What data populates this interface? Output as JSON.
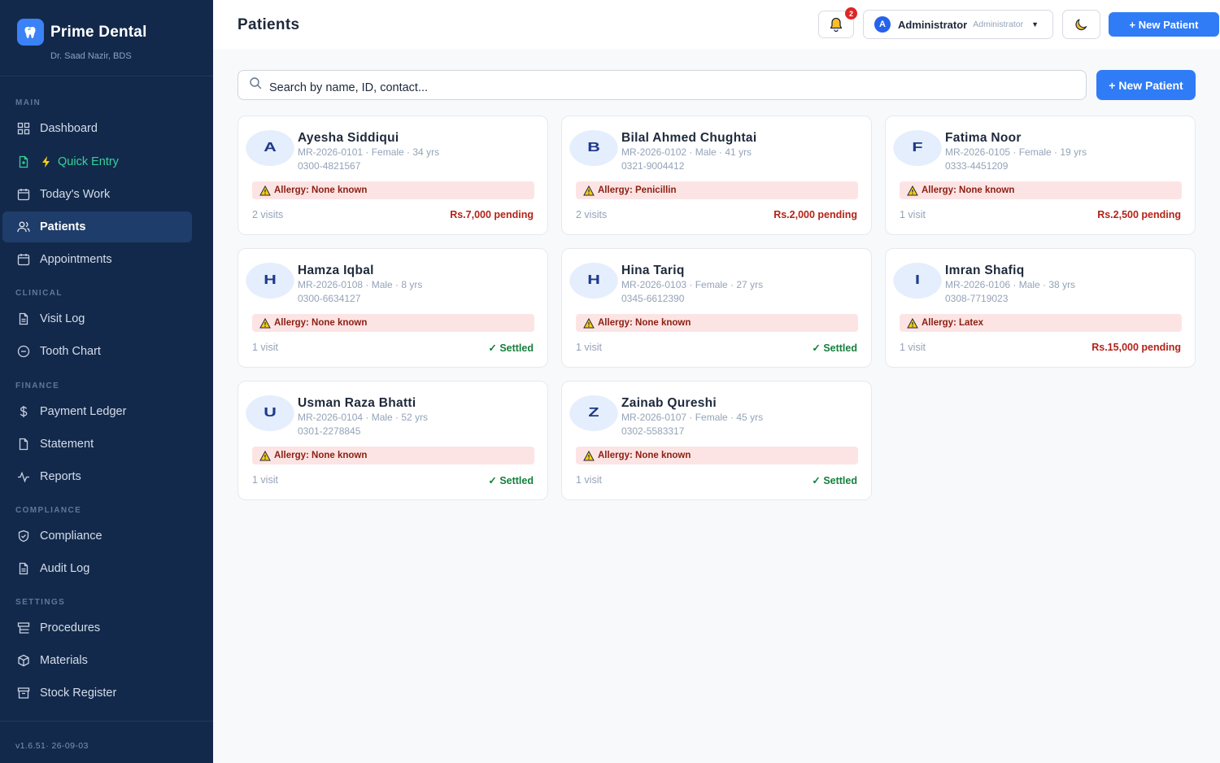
{
  "app": {
    "name": "Prime Dental",
    "doctor": "Dr. Saad Nazir, BDS",
    "version": "v1.6.51· 26-09-03"
  },
  "sidebar": {
    "sections": [
      {
        "label": "MAIN"
      },
      {
        "label": "CLINICAL"
      },
      {
        "label": "FINANCE"
      },
      {
        "label": "COMPLIANCE"
      },
      {
        "label": "SETTINGS"
      }
    ],
    "items": [
      {
        "label": "Dashboard",
        "icon": "grid-icon"
      },
      {
        "label": "Quick Entry",
        "icon": "file-icon",
        "prefix_icon": "lightning-icon"
      },
      {
        "label": "Today's Work",
        "icon": "calendar-icon"
      },
      {
        "label": "Patients",
        "icon": "users-icon",
        "active": true
      },
      {
        "label": "Appointments",
        "icon": "calendar-icon"
      },
      {
        "label": "Visit Log",
        "icon": "document-icon"
      },
      {
        "label": "Tooth Chart",
        "icon": "circle-icon"
      },
      {
        "label": "Payment Ledger",
        "icon": "dollar-icon"
      },
      {
        "label": "Statement",
        "icon": "document-icon"
      },
      {
        "label": "Reports",
        "icon": "activity-icon"
      },
      {
        "label": "Compliance",
        "icon": "shield-icon"
      },
      {
        "label": "Audit Log",
        "icon": "document-icon"
      },
      {
        "label": "Procedures",
        "icon": "list-icon"
      },
      {
        "label": "Materials",
        "icon": "box-icon"
      },
      {
        "label": "Stock Register",
        "icon": "archive-icon"
      }
    ]
  },
  "header": {
    "title": "Patients",
    "notification_count": "2",
    "user": {
      "initial": "A",
      "name": "Administrator",
      "role": "Administrator"
    },
    "new_patient_label": "+ New Patient"
  },
  "search": {
    "placeholder": "Search by name, ID, contact..."
  },
  "main": {
    "new_patient_label": "+ New Patient"
  },
  "patients": [
    {
      "initial": "A",
      "name": "Ayesha Siddiqui",
      "meta": "MR-2026-0101 · Female · 34 yrs",
      "phone": "0300-4821567",
      "allergy": "Allergy: None known",
      "visits": "2 visits",
      "balance": "Rs.7,000 pending",
      "status": "pending"
    },
    {
      "initial": "B",
      "name": "Bilal Ahmed Chughtai",
      "meta": "MR-2026-0102 · Male · 41 yrs",
      "phone": "0321-9004412",
      "allergy": "Allergy: Penicillin",
      "visits": "2 visits",
      "balance": "Rs.2,000 pending",
      "status": "pending"
    },
    {
      "initial": "F",
      "name": "Fatima Noor",
      "meta": "MR-2026-0105 · Female · 19 yrs",
      "phone": "0333-4451209",
      "allergy": "Allergy: None known",
      "visits": "1 visit",
      "balance": "Rs.2,500 pending",
      "status": "pending"
    },
    {
      "initial": "H",
      "name": "Hamza Iqbal",
      "meta": "MR-2026-0108 · Male · 8 yrs",
      "phone": "0300-6634127",
      "allergy": "Allergy: None known",
      "visits": "1 visit",
      "balance": "✓ Settled",
      "status": "settled"
    },
    {
      "initial": "H",
      "name": "Hina Tariq",
      "meta": "MR-2026-0103 · Female · 27 yrs",
      "phone": "0345-6612390",
      "allergy": "Allergy: None known",
      "visits": "1 visit",
      "balance": "✓ Settled",
      "status": "settled"
    },
    {
      "initial": "I",
      "name": "Imran Shafiq",
      "meta": "MR-2026-0106 · Male · 38 yrs",
      "phone": "0308-7719023",
      "allergy": "Allergy: Latex",
      "visits": "1 visit",
      "balance": "Rs.15,000 pending",
      "status": "pending"
    },
    {
      "initial": "U",
      "name": "Usman Raza Bhatti",
      "meta": "MR-2026-0104 · Male · 52 yrs",
      "phone": "0301-2278845",
      "allergy": "Allergy: None known",
      "visits": "1 visit",
      "balance": "✓ Settled",
      "status": "settled"
    },
    {
      "initial": "Z",
      "name": "Zainab Qureshi",
      "meta": "MR-2026-0107 · Female · 45 yrs",
      "phone": "0302-5583317",
      "allergy": "Allergy: None known",
      "visits": "1 visit",
      "balance": "✓ Settled",
      "status": "settled"
    }
  ],
  "colors": {
    "sidebar_bg": "#13294b",
    "accent": "#2f7cf6",
    "pending": "#b42318",
    "settled": "#15803d",
    "allergy_bg": "#fde4e4",
    "quick_entry": "#34d399"
  }
}
